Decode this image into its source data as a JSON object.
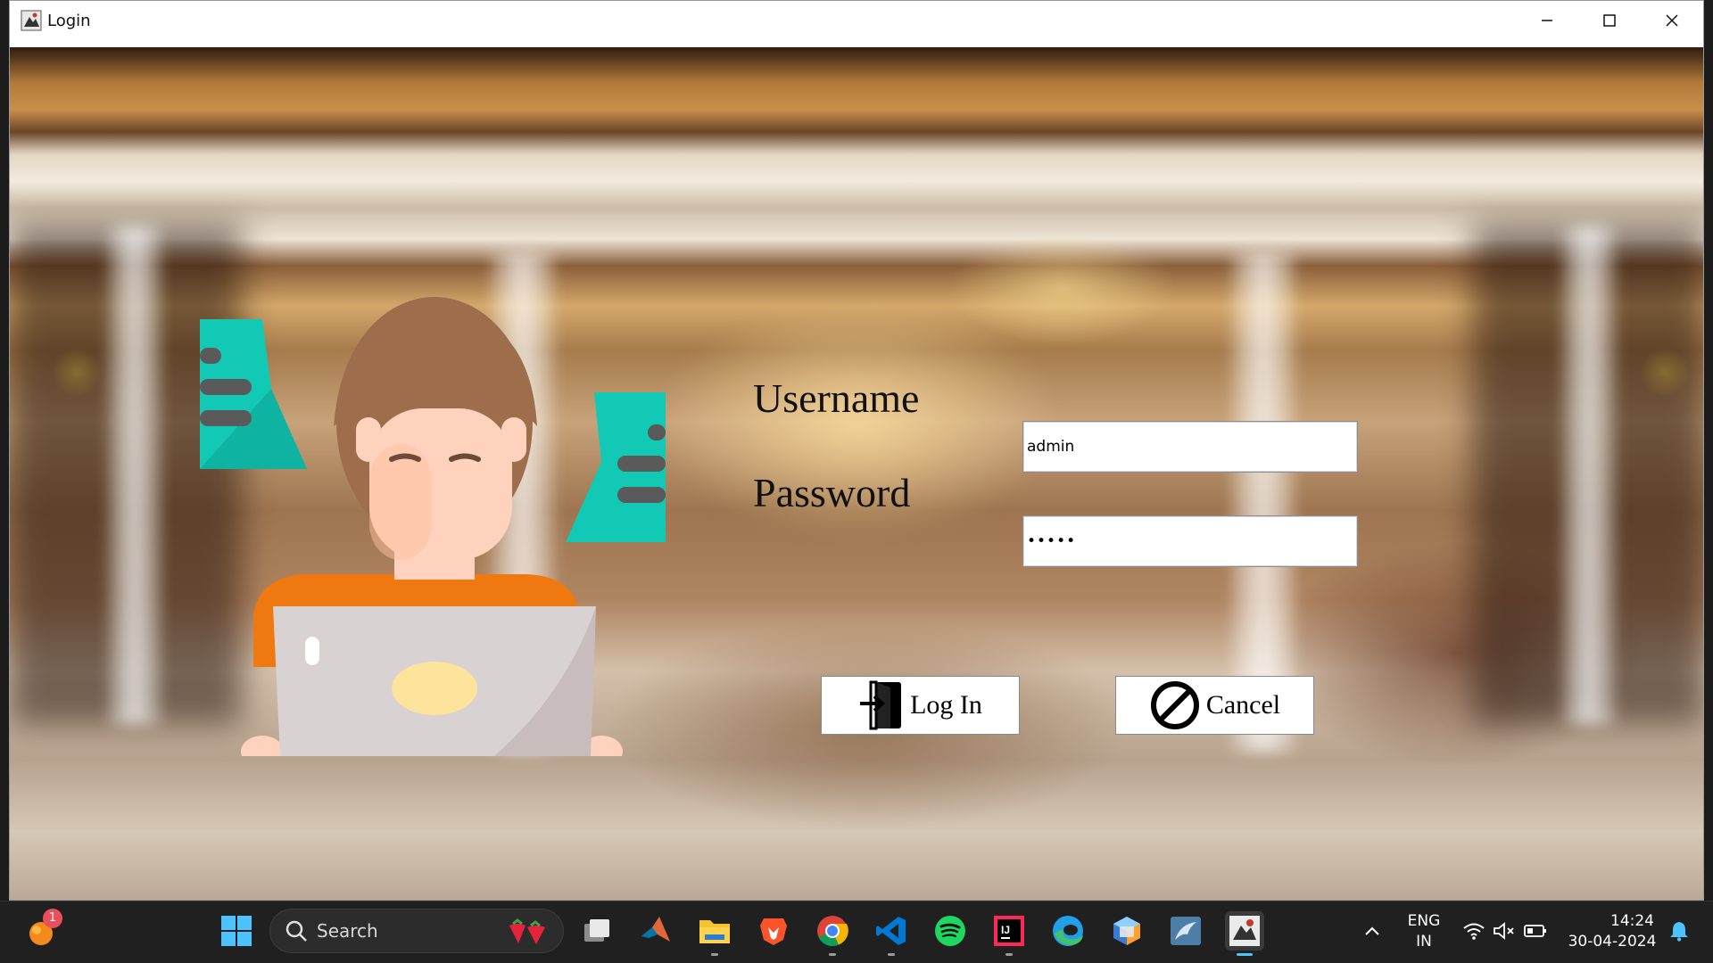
{
  "window": {
    "title": "Login",
    "controls": {
      "minimize": "minimize-icon",
      "maximize": "maximize-icon",
      "close": "close-icon"
    }
  },
  "form": {
    "username_label": "Username",
    "password_label": "Password",
    "username_value": "admin",
    "password_value": "•••••",
    "login_label": "Log In",
    "cancel_label": "Cancel"
  },
  "taskbar": {
    "notification_badge": "1",
    "search_placeholder": "Search",
    "apps": [
      "copilot-icon",
      "task-view-icon",
      "matlab-icon",
      "file-explorer-icon",
      "brave-icon",
      "chrome-icon",
      "vscode-icon",
      "spotify-icon",
      "intellij-icon",
      "edge-icon",
      "virtualbox-icon",
      "mysql-workbench-icon",
      "java-app-icon"
    ],
    "language_line1": "ENG",
    "language_line2": "IN",
    "time": "14:24",
    "date": "30-04-2024"
  },
  "colors": {
    "teal": "#12c9b5",
    "orange": "#f07810",
    "taskbar": "#202020",
    "accent": "#4cc2ff"
  }
}
